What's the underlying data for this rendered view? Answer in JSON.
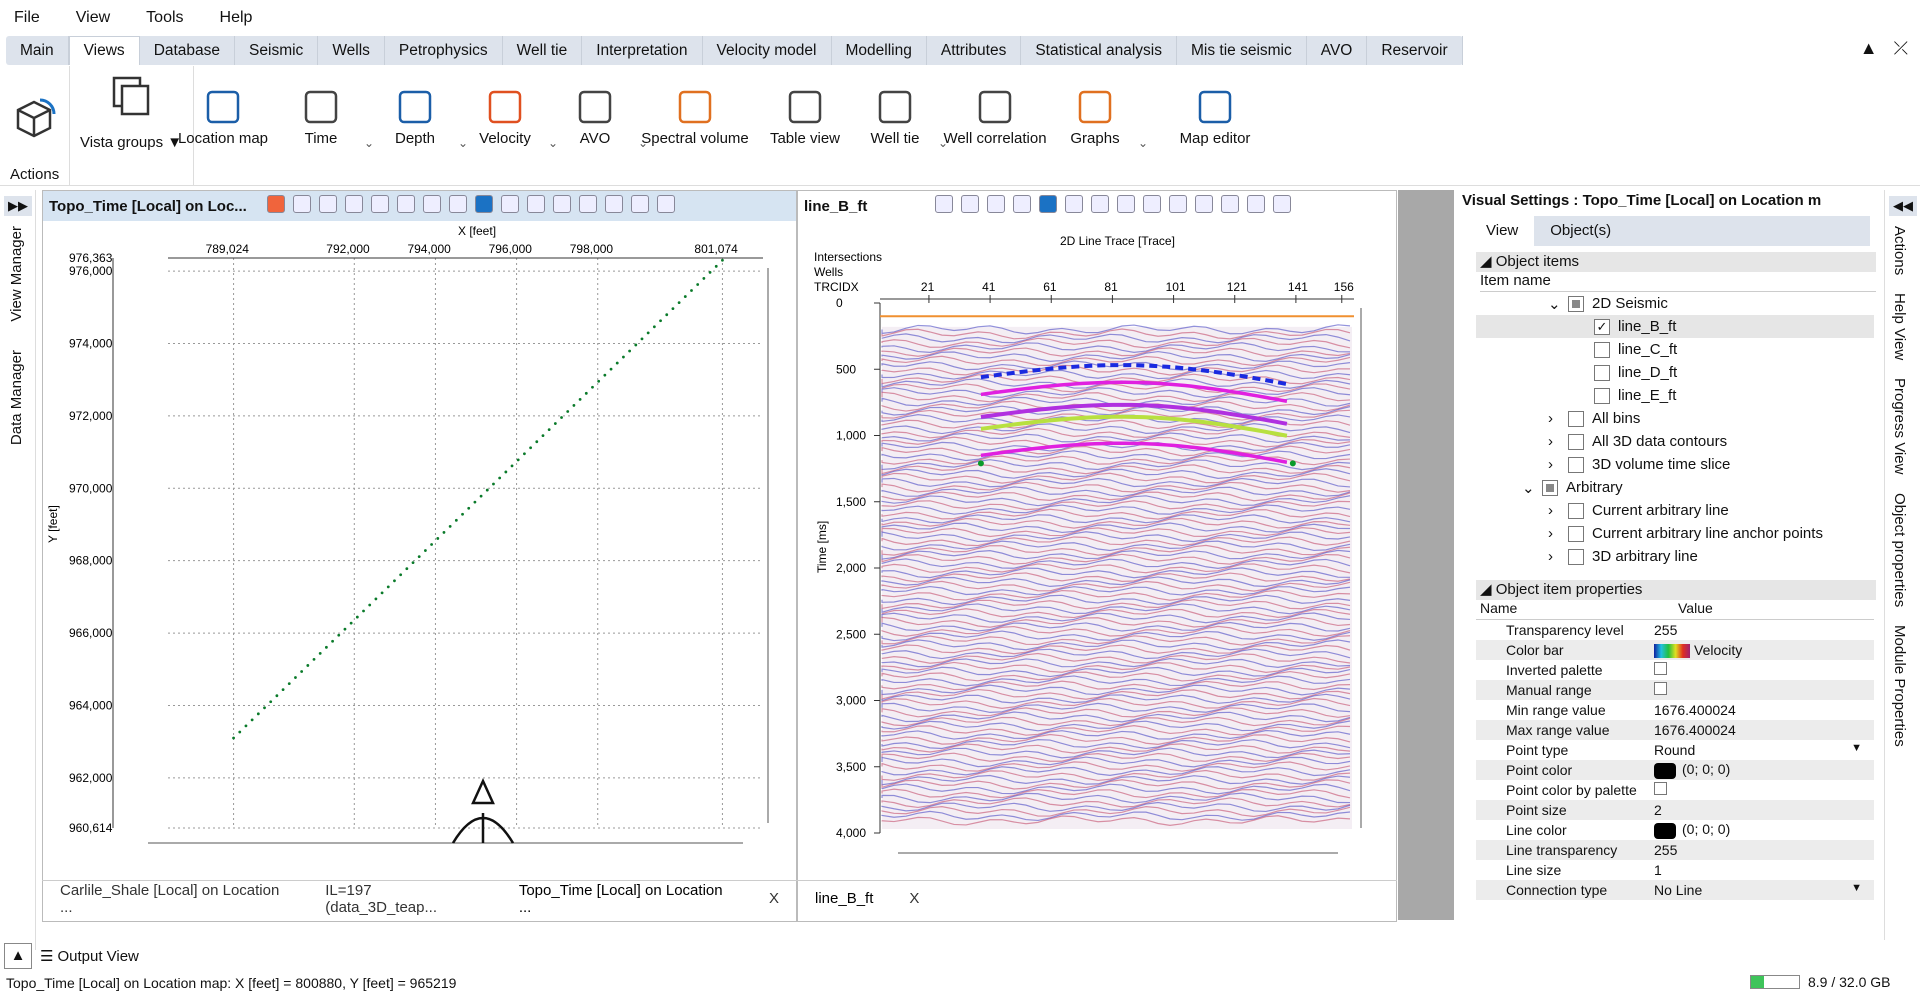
{
  "menu": {
    "file": "File",
    "view": "View",
    "tools": "Tools",
    "help": "Help"
  },
  "tabs": [
    "Main",
    "Views",
    "Database",
    "Seismic",
    "Wells",
    "Petrophysics",
    "Well tie",
    "Interpretation",
    "Velocity model",
    "Modelling",
    "Attributes",
    "Statistical analysis",
    "Mis tie seismic",
    "AVO",
    "Reservoir"
  ],
  "active_tab": "Views",
  "ribbon": {
    "actions_label": "Actions",
    "vista_groups": "Vista groups ▼",
    "items": [
      "Location map",
      "Time",
      "Depth",
      "Velocity",
      "AVO",
      "Spectral volume",
      "Table view",
      "Well tie",
      "Well correlation",
      "Graphs",
      "Map editor"
    ]
  },
  "left_sidebar": {
    "view_manager": "View Manager",
    "data_manager": "Data Manager"
  },
  "map_panel": {
    "title": "Topo_Time [Local] on Loc...",
    "x_axis_label": "X [feet]",
    "x_ticks": [
      "789,024",
      "792,000",
      "794,000",
      "796,000",
      "798,000",
      "801,074"
    ],
    "y_axis_label": "Y [feet]",
    "y_ticks": [
      "976,363",
      "976,000",
      "974,000",
      "972,000",
      "970,000",
      "968,000",
      "966,000",
      "964,000",
      "962,000",
      "960,614"
    ]
  },
  "section_panel": {
    "title": "line_B_ft",
    "header_label": "2D Line Trace [Trace]",
    "row_labels": [
      "Intersections",
      "Wells",
      "TRCIDX"
    ],
    "x_ticks": [
      "21",
      "41",
      "61",
      "81",
      "101",
      "121",
      "141",
      "156"
    ],
    "y_axis_label": "Time [ms]",
    "y_ticks": [
      "0",
      "500",
      "1,000",
      "1,500",
      "2,000",
      "2,500",
      "3,000",
      "3,500",
      "4,000"
    ]
  },
  "bottom_tabs_left": [
    "Carlile_Shale [Local] on Location ...",
    "IL=197 (data_3D_teap...",
    "Topo_Time [Local] on Location ..."
  ],
  "bottom_tabs_right": [
    "line_B_ft"
  ],
  "close_glyph": "X",
  "visual_settings": {
    "title": "Visual Settings : Topo_Time [Local] on Location m",
    "tabs": [
      "View",
      "Object(s)"
    ],
    "object_items_label": "Object items",
    "item_name_header": "Item name",
    "tree": [
      {
        "label": "2D Seismic",
        "indent": 2,
        "expander": "⌄",
        "checked": "partial"
      },
      {
        "label": "line_B_ft",
        "indent": 3,
        "expander": "",
        "checked": "yes",
        "selected": true
      },
      {
        "label": "line_C_ft",
        "indent": 3,
        "expander": "",
        "checked": "no"
      },
      {
        "label": "line_D_ft",
        "indent": 3,
        "expander": "",
        "checked": "no"
      },
      {
        "label": "line_E_ft",
        "indent": 3,
        "expander": "",
        "checked": "no"
      },
      {
        "label": "All bins",
        "indent": 2,
        "expander": "›",
        "checked": "no"
      },
      {
        "label": "All 3D data contours",
        "indent": 2,
        "expander": "›",
        "checked": "no"
      },
      {
        "label": "3D volume time slice",
        "indent": 2,
        "expander": "›",
        "checked": "no"
      },
      {
        "label": "Arbitrary",
        "indent": 1,
        "expander": "⌄",
        "checked": "partial"
      },
      {
        "label": "Current arbitrary line",
        "indent": 2,
        "expander": "›",
        "checked": "no"
      },
      {
        "label": "Current arbitrary line anchor points",
        "indent": 2,
        "expander": "›",
        "checked": "no"
      },
      {
        "label": "3D arbitrary line",
        "indent": 2,
        "expander": "›",
        "checked": "no"
      }
    ],
    "props_label": "Object item properties",
    "props_headers": {
      "name": "Name",
      "value": "Value"
    },
    "props": [
      {
        "name": "Transparency level",
        "value": "255"
      },
      {
        "name": "Color bar",
        "value": "Velocity"
      },
      {
        "name": "Inverted palette",
        "value": ""
      },
      {
        "name": "Manual range",
        "value": ""
      },
      {
        "name": "Min range value",
        "value": "1676.400024"
      },
      {
        "name": "Max range value",
        "value": "1676.400024"
      },
      {
        "name": "Point type",
        "value": "Round"
      },
      {
        "name": "Point color",
        "value": "(0; 0; 0)"
      },
      {
        "name": "Point color by palette",
        "value": ""
      },
      {
        "name": "Point size",
        "value": "2"
      },
      {
        "name": "Line color",
        "value": "(0; 0; 0)"
      },
      {
        "name": "Line transparency",
        "value": "255"
      },
      {
        "name": "Line size",
        "value": "1"
      },
      {
        "name": "Connection type",
        "value": "No Line"
      }
    ]
  },
  "right_sidebar": [
    "Actions",
    "Help View",
    "Progress View",
    "Object properties",
    "Module Properties"
  ],
  "output_view": "Output View",
  "status": {
    "text": "Topo_Time [Local] on Location map:   X [feet] = 800880, Y [feet] = 965219",
    "memory": "8.9 / 32.0 GB",
    "memory_fraction": 0.28
  }
}
